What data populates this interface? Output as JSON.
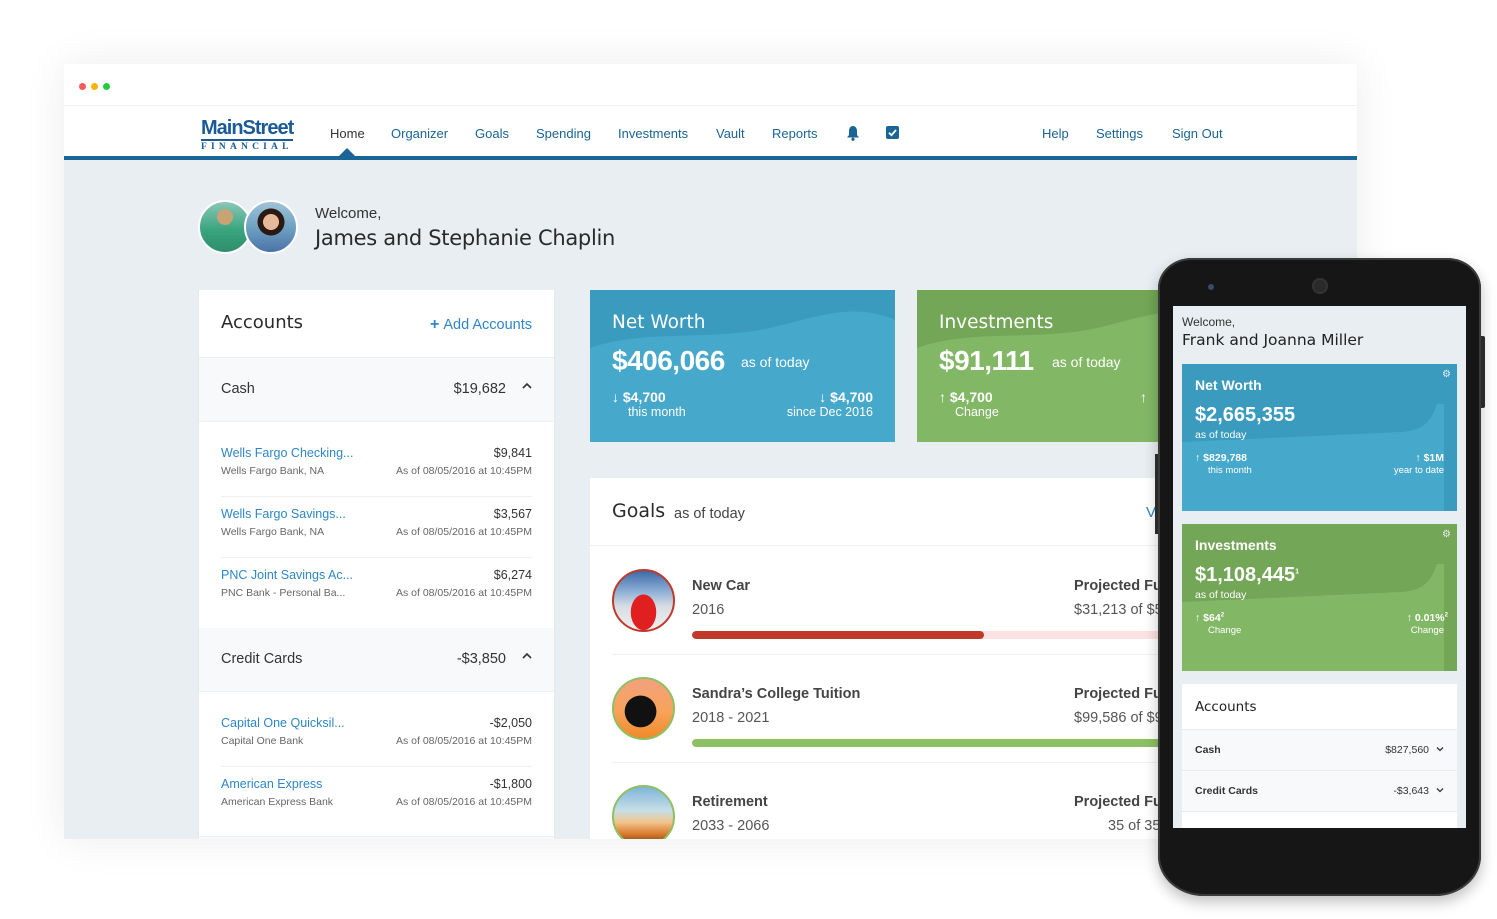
{
  "window": {
    "controls": [
      "close",
      "minimize",
      "maximize"
    ]
  },
  "brand": {
    "line1": "MainStreet",
    "line2": "FINANCIAL",
    "color": "#1a5a96"
  },
  "nav": {
    "items": [
      {
        "label": "Home",
        "active": true
      },
      {
        "label": "Organizer"
      },
      {
        "label": "Goals"
      },
      {
        "label": "Spending"
      },
      {
        "label": "Investments"
      },
      {
        "label": "Vault"
      },
      {
        "label": "Reports"
      }
    ],
    "icons": [
      "bell-icon",
      "checkbox-icon"
    ],
    "right": [
      {
        "label": "Help"
      },
      {
        "label": "Settings"
      },
      {
        "label": "Sign Out"
      }
    ]
  },
  "welcome": {
    "greeting": "Welcome,",
    "name": "James and Stephanie Chaplin"
  },
  "accounts": {
    "title": "Accounts",
    "add_label": "Add Accounts",
    "groups": [
      {
        "name": "Cash",
        "total": "$19,682",
        "expanded": true,
        "rows": [
          {
            "name": "Wells Fargo Checking...",
            "institution": "Wells Fargo Bank, NA",
            "amount": "$9,841",
            "as_of": "As of 08/05/2016 at 10:45PM"
          },
          {
            "name": "Wells Fargo Savings...",
            "institution": "Wells Fargo Bank, NA",
            "amount": "$3,567",
            "as_of": "As of 08/05/2016 at 10:45PM"
          },
          {
            "name": "PNC Joint Savings Ac...",
            "institution": "PNC Bank - Personal Ba...",
            "amount": "$6,274",
            "as_of": "As of 08/05/2016 at 10:45PM"
          }
        ]
      },
      {
        "name": "Credit Cards",
        "total": "-$3,850",
        "expanded": true,
        "rows": [
          {
            "name": "Capital One Quicksil...",
            "institution": "Capital One Bank",
            "amount": "-$2,050",
            "as_of": "As of 08/05/2016 at 10:45PM"
          },
          {
            "name": "American Express",
            "institution": "American Express Bank",
            "amount": "-$1,800",
            "as_of": "As of 08/05/2016 at 10:45PM"
          }
        ]
      }
    ]
  },
  "net_worth": {
    "title": "Net Worth",
    "value": "$406,066",
    "as_of": "as of today",
    "stat1": {
      "direction": "down",
      "value": "$4,700",
      "label": "this month"
    },
    "stat2": {
      "direction": "down",
      "value": "$4,700",
      "label": "since Dec 2016"
    },
    "color": "#46a8cb"
  },
  "investments": {
    "title": "Investments",
    "value": "$91,111",
    "as_of": "as of today",
    "stat1": {
      "direction": "up",
      "value": "$4,700",
      "label": "Change"
    },
    "stat2": {
      "direction": "up"
    },
    "color": "#82b865"
  },
  "goals": {
    "title": "Goals",
    "as_of": "as of today",
    "view_link": "Vi",
    "items": [
      {
        "name": "New Car",
        "years": "2016",
        "projected_label": "Projected Fu",
        "projected_value": "$31,213 of $5",
        "progress": 0.54,
        "status_color": "#c0392b",
        "track_color": "#fbe3e3",
        "image": "red-car"
      },
      {
        "name": "Sandra’s College Tuition",
        "years": "2018 - 2021",
        "projected_label": "Projected Fu",
        "projected_value": "$99,586 of $9",
        "progress": 1.0,
        "status_color": "#8cc063",
        "track_color": "#e6f2dc",
        "image": "graduate-silhouette"
      },
      {
        "name": "Retirement",
        "years": "2033 - 2066",
        "projected_label": "Projected Fu",
        "projected_value": "35 of 35",
        "progress": null,
        "status_color": "#8cc063",
        "image": "beach-chairs"
      }
    ]
  },
  "mobile": {
    "greeting": "Welcome,",
    "name": "Frank and Joanna Miller",
    "net_worth": {
      "title": "Net Worth",
      "value": "$2,665,355",
      "as_of": "as of today",
      "stat1": {
        "direction": "up",
        "value": "$829,788",
        "label": "this month"
      },
      "stat2": {
        "direction": "up",
        "value": "$1M",
        "label": "year to date"
      }
    },
    "investments": {
      "title": "Investments",
      "value": "$1,108,445",
      "footnote": "1",
      "as_of": "as of today",
      "stat1": {
        "direction": "up",
        "value": "$64",
        "footnote": "2",
        "label": "Change"
      },
      "stat2": {
        "direction": "up",
        "value": "0.01%",
        "footnote": "2",
        "label": "Change"
      }
    },
    "accounts": {
      "title": "Accounts",
      "rows": [
        {
          "name": "Cash",
          "amount": "$827,560"
        },
        {
          "name": "Credit Cards",
          "amount": "-$3,643"
        }
      ]
    }
  }
}
